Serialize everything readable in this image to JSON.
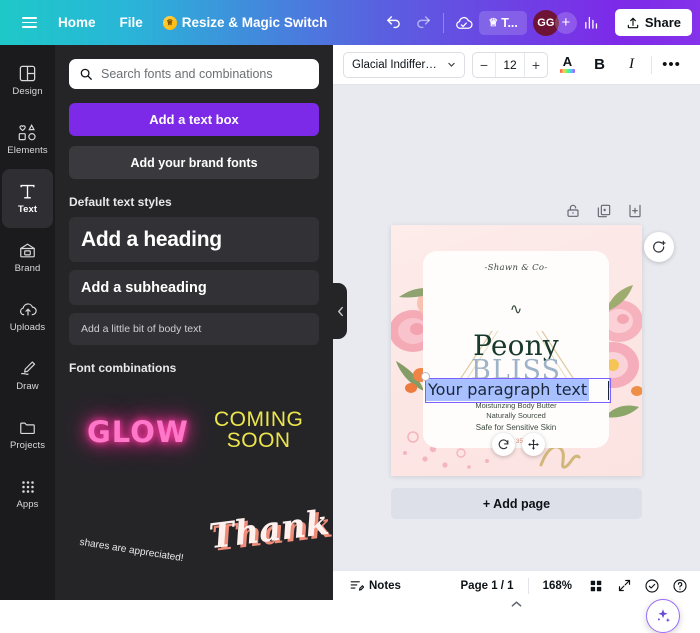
{
  "topbar": {
    "menu_icon": "hamburger-icon",
    "home_label": "Home",
    "file_label": "File",
    "resize_label": "Resize & Magic Switch",
    "undo_icon": "undo-icon",
    "redo_icon": "redo-icon",
    "cloud_icon": "cloud-saved-icon",
    "try_label": "T...",
    "avatar_initials": "GG",
    "plus_label": "+",
    "analytics_icon": "analytics-icon",
    "share_label": "Share",
    "gradient_from": "#1ec8c8",
    "gradient_to": "#7d2ae8"
  },
  "rail": {
    "items": [
      {
        "label": "Design",
        "icon": "design-icon",
        "active": false
      },
      {
        "label": "Elements",
        "icon": "elements-icon",
        "active": false
      },
      {
        "label": "Text",
        "icon": "text-icon",
        "active": true
      },
      {
        "label": "Brand",
        "icon": "brand-icon",
        "active": false
      },
      {
        "label": "Uploads",
        "icon": "uploads-icon",
        "active": false
      },
      {
        "label": "Draw",
        "icon": "draw-icon",
        "active": false
      },
      {
        "label": "Projects",
        "icon": "projects-icon",
        "active": false
      },
      {
        "label": "Apps",
        "icon": "apps-icon",
        "active": false
      }
    ]
  },
  "panel": {
    "search_placeholder": "Search fonts and combinations",
    "search_value": "",
    "search_icon": "search-icon",
    "add_text_box_label": "Add a text box",
    "brand_fonts_label": "Add your brand fonts",
    "default_styles_title": "Default text styles",
    "styles": [
      {
        "label": "Add a heading"
      },
      {
        "label": "Add a subheading"
      },
      {
        "label": "Add a little bit of body text"
      }
    ],
    "combinations_title": "Font combinations",
    "combinations": [
      {
        "text": "GLOW",
        "color": "#ff77c8"
      },
      {
        "text": "COMING\nSOON",
        "line1": "COMING",
        "line2": "SOON",
        "color": "#ece64c"
      },
      {
        "text": "shares are appreciated!",
        "color": "#e9e9ec"
      },
      {
        "text": "Thank you!",
        "line1": "Thank",
        "color": "#fff2ee"
      }
    ],
    "collapse_icon": "chevron-left-icon"
  },
  "edit_toolbar": {
    "font_name": "Glacial Indiffere...",
    "font_chevron": "chevron-down-icon",
    "size_decrease": "−",
    "font_size": "12",
    "size_increase": "+",
    "text_color_icon": "text-color-icon",
    "bold_label": "B",
    "italic_label": "I",
    "more_label": "•••"
  },
  "page_actions": {
    "lock_icon": "lock-icon",
    "duplicate_icon": "duplicate-page-icon",
    "add_page_icon": "add-page-icon"
  },
  "canvas": {
    "design": {
      "brand_line": "-Shawn & Co-",
      "monogram": "∿",
      "title": "Peony",
      "subtitle": "BLISS",
      "body_line1": "Moisturizing Body Butter",
      "body_line2": "Naturally Sourced",
      "safe_line": "Safe for Sensitive Skin",
      "volume": "12 oz | 355 mL",
      "bg_color": "#fdeceb",
      "card_color": "#fffdfc",
      "title_color": "#173a2c",
      "accent_color": "#d98a76"
    },
    "selection": {
      "text": "Your paragraph text",
      "rotate_icon": "rotate-handle-icon",
      "move_icon": "move-handle-icon",
      "border_color": "#7b61ff",
      "highlight_color": "#a8c0ff"
    },
    "comment_icon": "add-comment-icon",
    "add_page_label": "+ Add page",
    "magic_icon": "magic-sparkle-icon",
    "scroll_up_icon": "chevron-up-icon"
  },
  "bottombar": {
    "notes_icon": "notes-icon",
    "notes_label": "Notes",
    "page_indicator": "Page 1 / 1",
    "zoom_level": "168%",
    "grid_icon": "grid-view-icon",
    "fullscreen_icon": "fullscreen-icon",
    "check_icon": "check-circle-icon",
    "help_icon": "help-icon"
  }
}
